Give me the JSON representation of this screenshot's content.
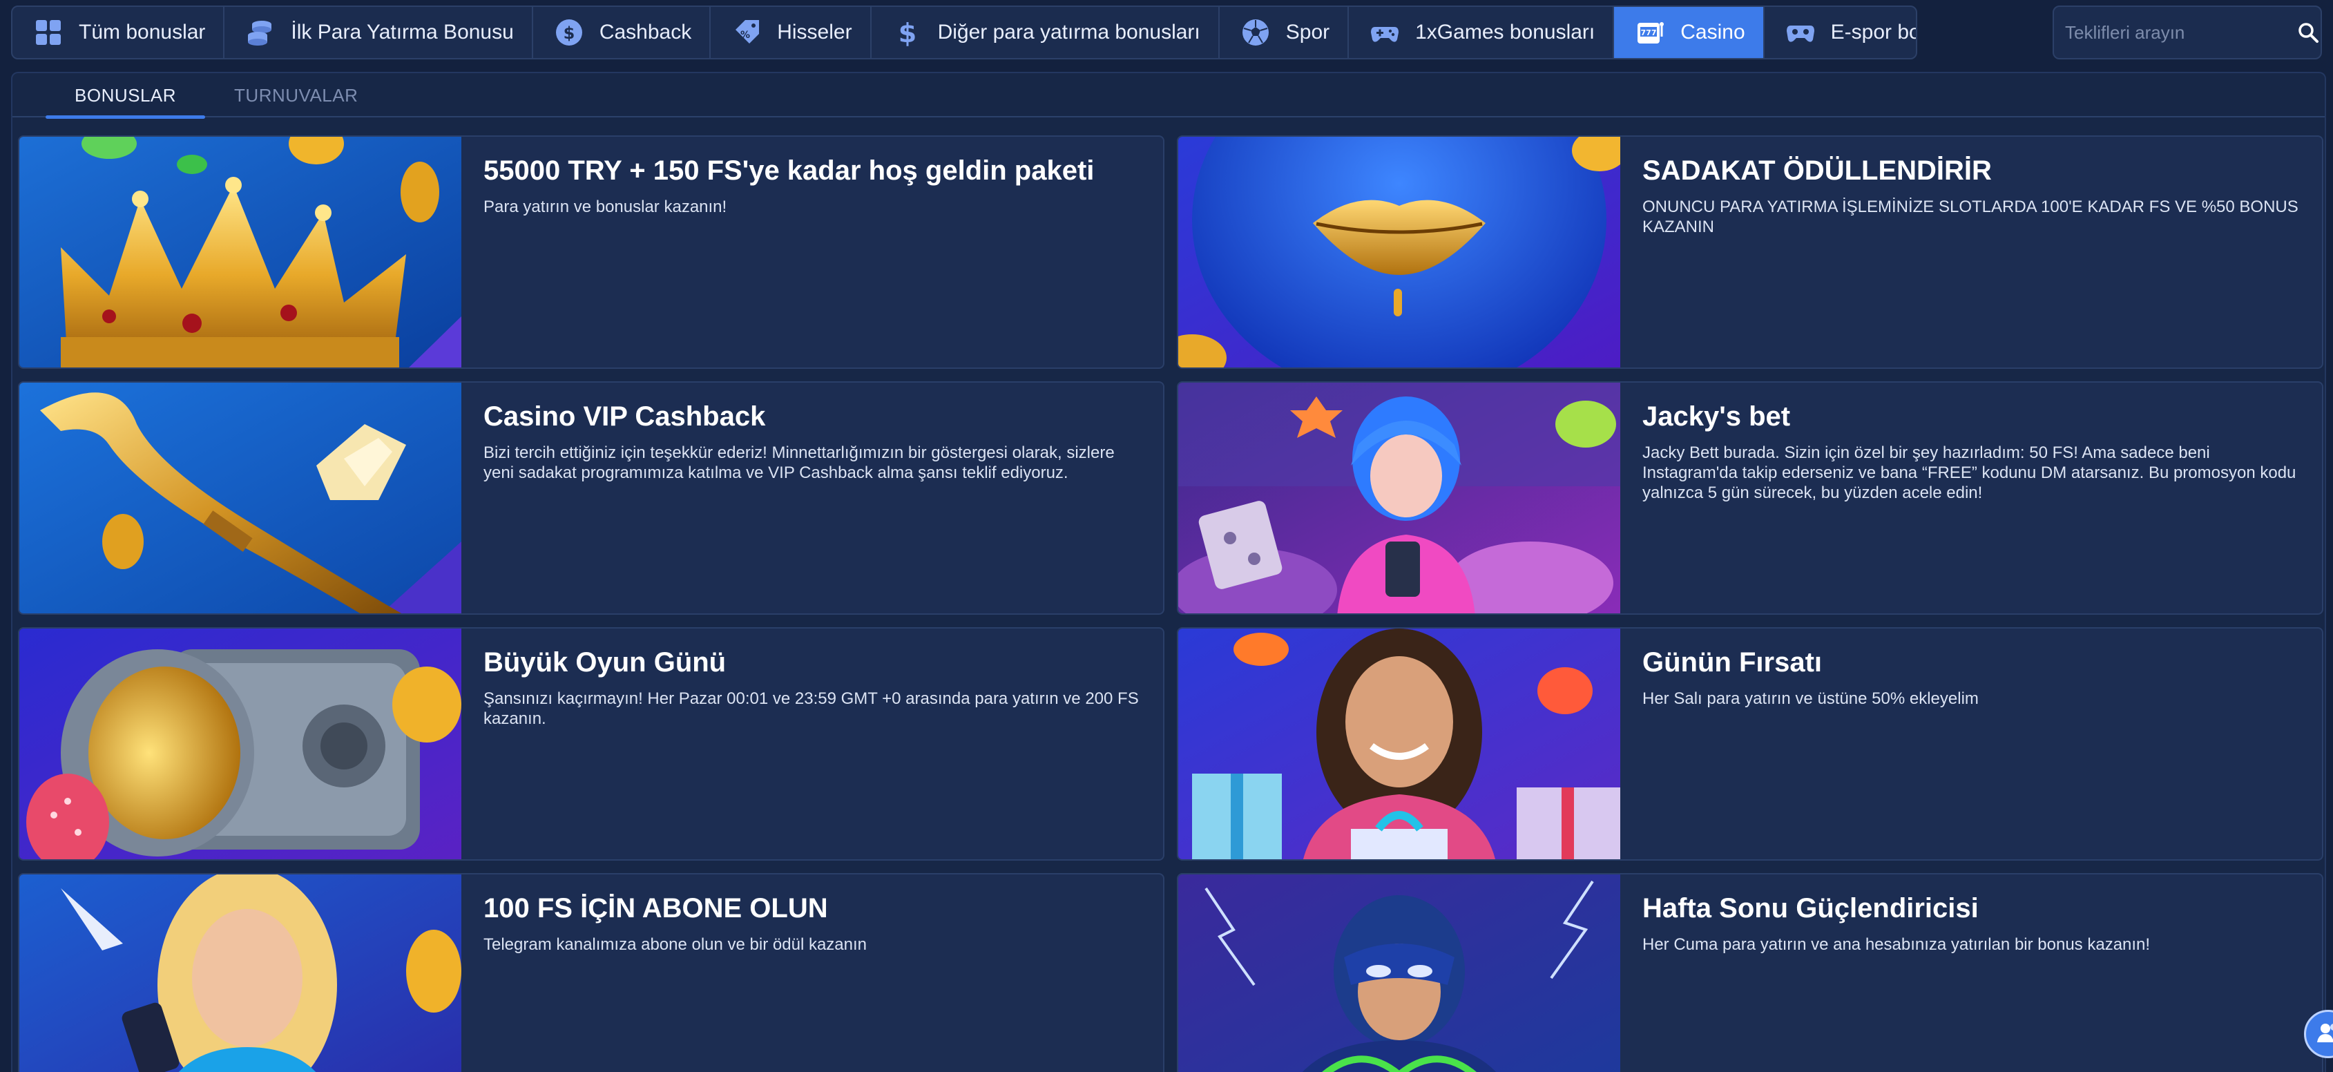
{
  "nav": {
    "items": [
      {
        "label": "Tüm bonuslar",
        "icon": "grid-icon"
      },
      {
        "label": "İlk Para Yatırma Bonusu",
        "icon": "coins-icon"
      },
      {
        "label": "Cashback",
        "icon": "dollar-coin-icon"
      },
      {
        "label": "Hisseler",
        "icon": "ticket-percent-icon"
      },
      {
        "label": "Diğer para yatırma bonusları",
        "icon": "dollar-icon"
      },
      {
        "label": "Spor",
        "icon": "soccer-ball-icon"
      },
      {
        "label": "1xGames bonusları",
        "icon": "gamepad-icon"
      },
      {
        "label": "Casino",
        "icon": "slot-777-icon"
      },
      {
        "label": "E-spor bonusları",
        "icon": "esports-gamepad-icon"
      }
    ],
    "active_index": 7
  },
  "search": {
    "placeholder": "Teklifleri arayın",
    "icon": "search-icon"
  },
  "tabs": [
    {
      "label": "BONUSLAR"
    },
    {
      "label": "TURNUVALAR"
    }
  ],
  "cards": [
    {
      "title": "55000 TRY + 150 FS'ye kadar hoş geldin paketi",
      "desc": "Para yatırın ve bonuslar kazanın!",
      "image": "golden-crown"
    },
    {
      "title": "SADAKAT ÖDÜLLENDİRİR",
      "desc": "ONUNCU PARA YATIRMA İŞLEMİNİZE SLOTLARDA 100'E KADAR FS VE %50 BONUS KAZANIN",
      "image": "blue-face-gold-lips"
    },
    {
      "title": "Casino VIP Cashback",
      "desc": "Bizi tercih ettiğiniz için teşekkür ederiz! Minnettarlığımızın bir göstergesi olarak, sizlere yeni sadakat programımıza katılma ve VIP Cashback alma şansı teklif ediyoruz.",
      "image": "golden-horn-diamond"
    },
    {
      "title": "Jacky's bet",
      "desc": "Jacky Bett burada. Sizin için özel bir şey hazırladım: 50 FS! Ama sadece beni Instagram'da takip ederseniz ve bana “FREE” kodunu DM atarsanız. Bu promosyon kodu yalnızca 5 gün sürecek, bu yüzden acele edin!",
      "image": "girl-with-phone"
    },
    {
      "title": "Büyük Oyun Günü",
      "desc": "Şansınızı kaçırmayın! Her Pazar 00:01 ve 23:59 GMT +0 arasında para yatırın ve 200 FS kazanın.",
      "image": "vault-gold"
    },
    {
      "title": "Günün Fırsatı",
      "desc": "Her Salı para yatırın ve üstüne 50% ekleyelim",
      "image": "woman-gifts"
    },
    {
      "title": "100 FS İÇİN ABONE OLUN",
      "desc": "Telegram kanalımıza abone olun ve bir ödül kazanın",
      "image": "blonde-phone"
    },
    {
      "title": "Hafta Sonu Güçlendiricisi",
      "desc": "Her Cuma para yatırın ve ana hesabınıza yatırılan bir bonus kazanın!",
      "image": "superhero"
    }
  ],
  "colors": {
    "accent": "#3d7bea",
    "background": "#13213e",
    "card": "#1c2d52"
  }
}
